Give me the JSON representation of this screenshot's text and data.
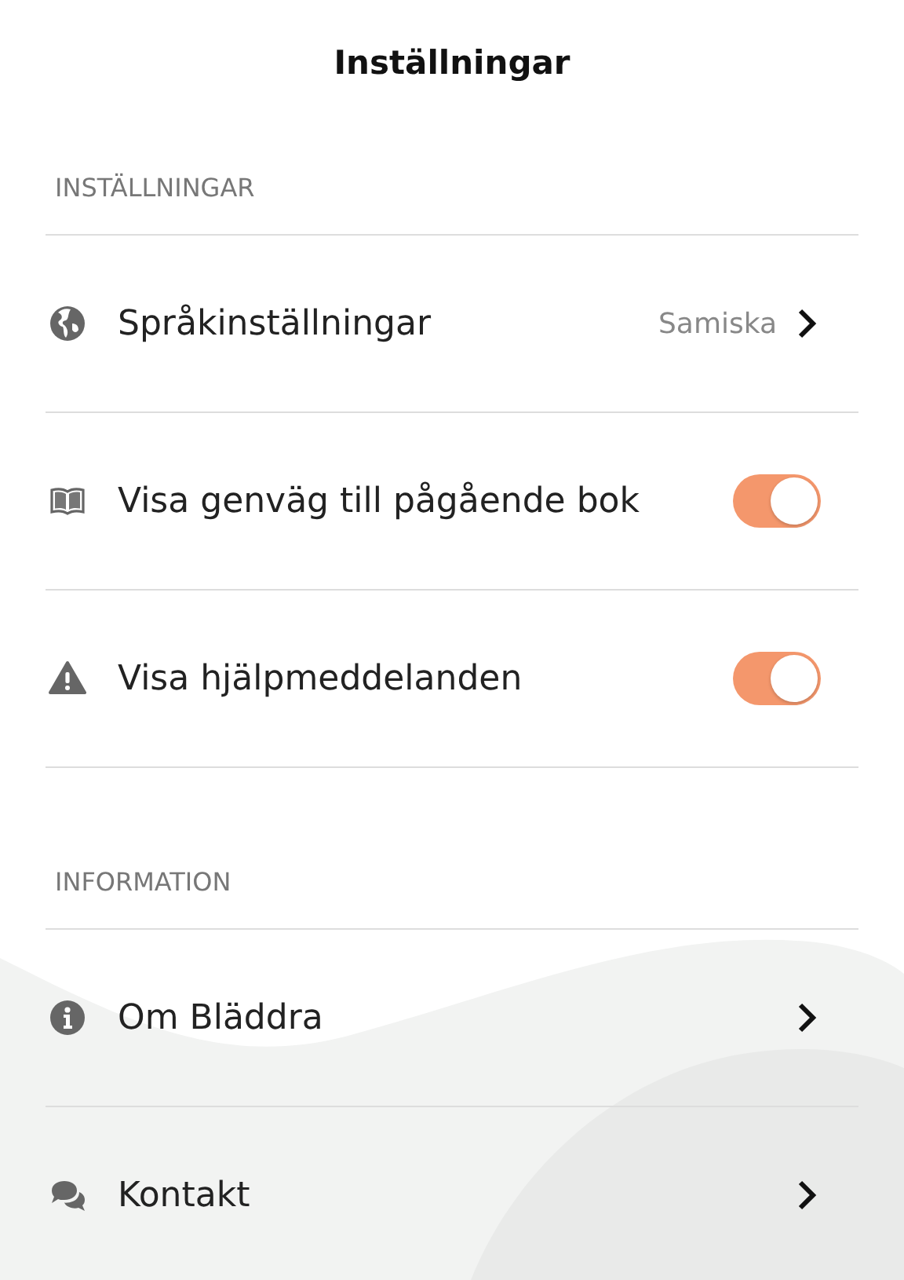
{
  "header": {
    "title": "Inställningar"
  },
  "sections": [
    {
      "heading": "INSTÄLLNINGAR",
      "rows": [
        {
          "kind": "link",
          "label": "Språkinställningar",
          "value": "Samiska"
        },
        {
          "kind": "toggle",
          "label": "Visa genväg till pågående bok",
          "on": true
        },
        {
          "kind": "toggle",
          "label": "Visa hjälpmeddelanden",
          "on": true
        }
      ]
    },
    {
      "heading": "INFORMATION",
      "rows": [
        {
          "kind": "link",
          "label": "Om Bläddra"
        },
        {
          "kind": "link",
          "label": "Kontakt"
        }
      ]
    }
  ]
}
